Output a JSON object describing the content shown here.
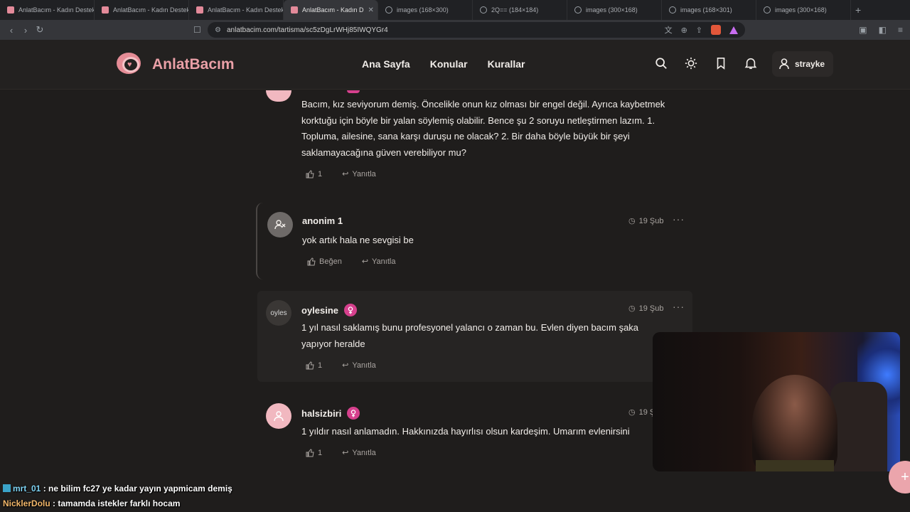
{
  "browser": {
    "tabs": [
      {
        "label": "AnlatBacım - Kadın Destek",
        "type": "site",
        "active": false
      },
      {
        "label": "AnlatBacım - Kadın Destek",
        "type": "site",
        "active": false
      },
      {
        "label": "AnlatBacım - Kadın Destek",
        "type": "site",
        "active": false
      },
      {
        "label": "AnlatBacım - Kadın D",
        "type": "site",
        "active": true
      },
      {
        "label": "images (168×300)",
        "type": "globe",
        "active": false
      },
      {
        "label": "2Q== (184×184)",
        "type": "globe",
        "active": false
      },
      {
        "label": "images (300×168)",
        "type": "globe",
        "active": false
      },
      {
        "label": "images (168×301)",
        "type": "globe",
        "active": false
      },
      {
        "label": "images (300×168)",
        "type": "globe",
        "active": false
      }
    ],
    "new_tab_glyph": "+",
    "url": "anlatbacim.com/tartisma/sc5zDgLrWHj85IWQYGr4"
  },
  "site": {
    "logo_text": "AnlatBacım",
    "nav": [
      "Ana Sayfa",
      "Konular",
      "Kurallar"
    ],
    "username": "strayke",
    "accent_color": "#e58c96"
  },
  "comments": {
    "c0": {
      "text": "Bacım, kız seviyorum demiş. Öncelikle onun kız olması bir engel değil. Ayrıca kaybetmek korktuğu için böyle bir yalan söylemiş olabilir. Bence şu 2 soruyu netleştirmen lazım. 1. Topluma, ailesine, sana karşı duruşu ne olacak? 2. Bir daha böyle büyük bir şeyi saklamayacağına güven verebiliyor mu?",
      "likes": "1",
      "reply": "Yanıtla"
    },
    "c1": {
      "author": "anonim 1",
      "date": "19 Şub",
      "text": "yok artık hala ne sevgisi be",
      "like_label": "Beğen",
      "reply": "Yanıtla"
    },
    "c2": {
      "author": "oylesine",
      "avatar_alt": "oyles",
      "date": "19 Şub",
      "text": "1 yıl nasıl saklamış bunu profesyonel yalancı o zaman bu. Evlen diyen bacım şaka yapıyor heralde",
      "likes": "1",
      "reply": "Yanıtla"
    },
    "c3": {
      "author": "halsizbiri",
      "date": "19 Ş",
      "text": "1 yıldır nasıl anlamadın. Hakkınızda hayırlısı olsun kardeşim. Umarım evlenirsini",
      "likes": "1",
      "reply": "Yanıtla"
    }
  },
  "chat": [
    {
      "user": "mrt_01",
      "message": ": ne bilim fc27 ye kadar yayın yapmicam demiş"
    },
    {
      "user": "NicklerDolu",
      "message": ": tamamda istekler farklı hocam"
    }
  ]
}
